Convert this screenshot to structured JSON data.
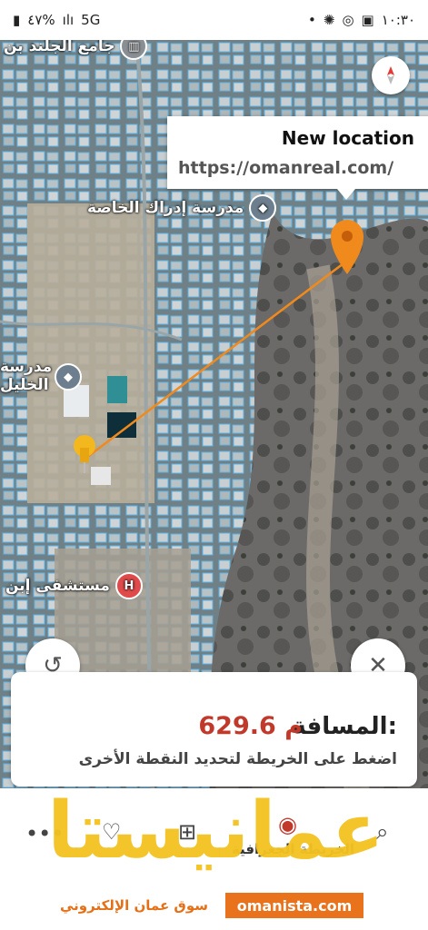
{
  "status": {
    "time": "١٠:٣٠",
    "battery": "٤٧%",
    "network": "5G"
  },
  "map": {
    "pois": {
      "mosque": "جامع الجلند بن",
      "school1": "مدرسة إدراك الخاصة",
      "school2a": "مدرسة",
      "school2b": "الخليل",
      "hospital": "مستشفى إبن"
    }
  },
  "tooltip": {
    "title": "New location",
    "url": "https://omanreal.com/"
  },
  "distance": {
    "label": "المسافة:",
    "value": "629.6 م",
    "hint": "اضغط على الخريطة لتحديد النقطة الأخرى"
  },
  "bottom": {
    "layer_label": "الخريطة الجغرافية",
    "icons": [
      "more-icon",
      "heart-icon",
      "add-place-icon",
      "navigation-icon",
      "search-icon"
    ]
  },
  "watermark": {
    "brand": "عمانيستا",
    "subtitle": "سوق عمان الإلكتروني",
    "url": "omanista.com"
  },
  "colors": {
    "accent": "#c0392b",
    "marker": "#f08a1d",
    "watermark": "#f3c322"
  }
}
